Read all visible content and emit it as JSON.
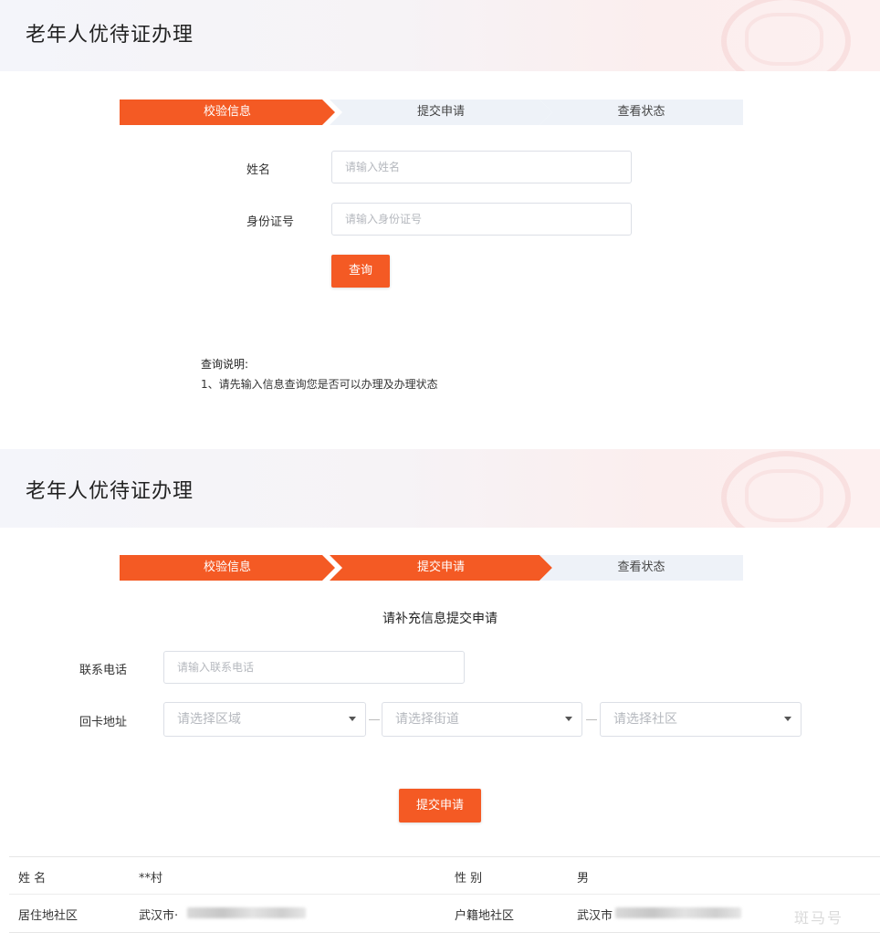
{
  "page_title": "老年人优待证办理",
  "steps": [
    "校验信息",
    "提交申请",
    "查看状态"
  ],
  "query_form": {
    "name_label": "姓名",
    "name_placeholder": "请输入姓名",
    "id_label": "身份证号",
    "id_placeholder": "请输入身份证号",
    "query_button": "查询",
    "note_title": "查询说明:",
    "note_line": "1、请先输入信息查询您是否可以办理及办理状态"
  },
  "apply_form": {
    "heading": "请补充信息提交申请",
    "phone_label": "联系电话",
    "phone_placeholder": "请输入联系电话",
    "address_label": "回卡地址",
    "area_placeholder": "请选择区域",
    "street_placeholder": "请选择街道",
    "community_placeholder": "请选择社区",
    "submit_button": "提交申请"
  },
  "info_table": {
    "name_label": "姓 名",
    "name_value": "**村",
    "gender_label": "性 别",
    "gender_value": "男",
    "residence_label": "居住地社区",
    "residence_value": "武汉市·",
    "household_label": "户籍地社区",
    "household_value": "武汉市"
  },
  "watermark": "斑马号",
  "colors": {
    "accent": "#f45a24",
    "step_inactive": "#eef2f8"
  }
}
